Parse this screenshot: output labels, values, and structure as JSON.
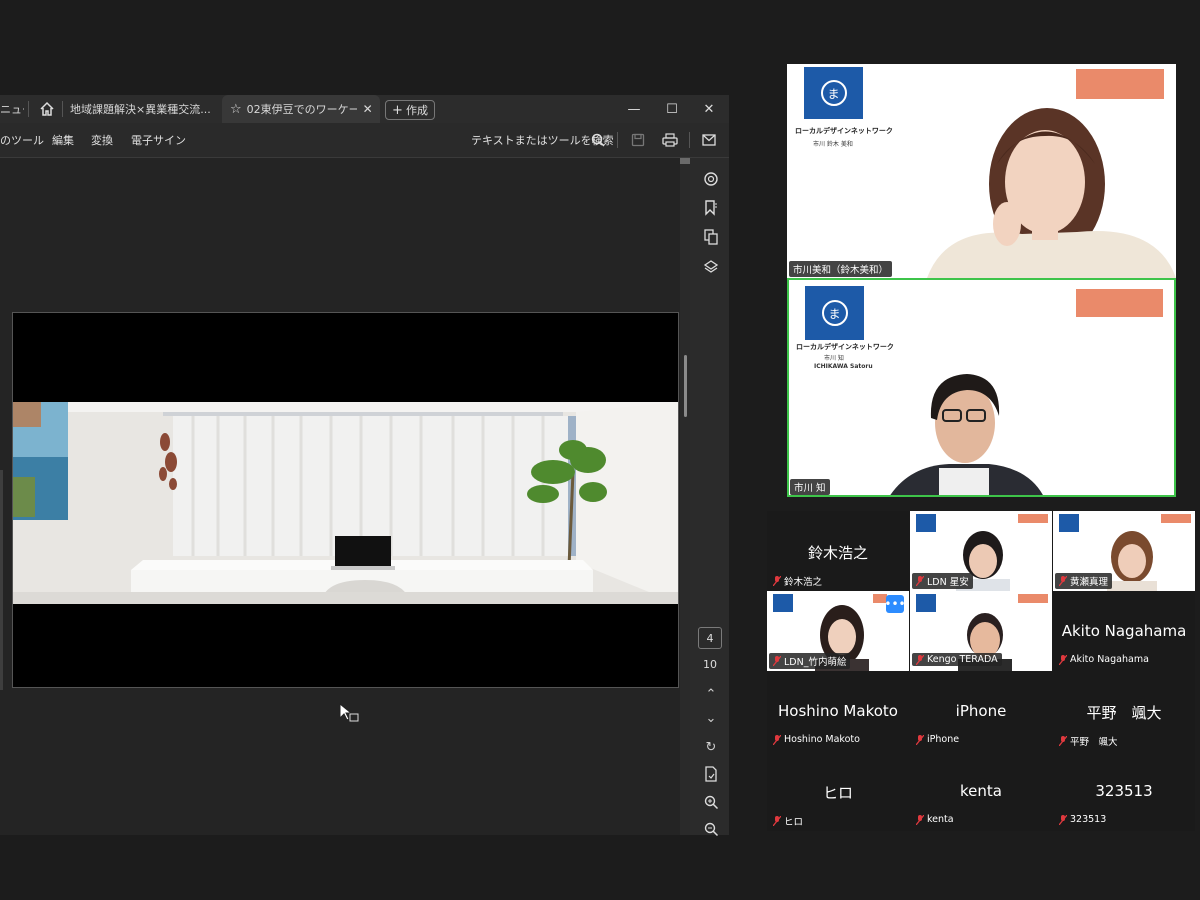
{
  "viewer": {
    "tabs": {
      "menu_partial": "ニュー",
      "tab1": "地域課題解決×異業種交流...",
      "tab2": "02東伊豆でのワーケー...",
      "create": "作成"
    },
    "menu": {
      "tools": "のツール",
      "edit": "編集",
      "convert": "変換",
      "esign": "電子サイン",
      "search": "テキストまたはツールを検索"
    },
    "page_current": "4",
    "page_total": "10"
  },
  "participants": {
    "speaker1": {
      "name": "市川美和（鈴木美和）",
      "org": "ローカルデザインネットワーク",
      "person": "市川 鈴木 美和",
      "logo_char": "ま"
    },
    "speaker2": {
      "name": "市川 知",
      "org": "ローカルデザインネットワーク",
      "person": "市川 知",
      "person_en": "ICHIKAWA Satoru",
      "logo_char": "ま"
    },
    "grid": [
      {
        "tag": "鈴木浩之",
        "big": "鈴木浩之"
      },
      {
        "tag": "LDN 星安"
      },
      {
        "tag": "黄瀬真理"
      },
      {
        "tag": "LDN_竹内萌絵"
      },
      {
        "tag": "Kengo TERADA"
      },
      {
        "tag": "Akito Nagahama",
        "big": "Akito Nagahama"
      },
      {
        "tag": "Hoshino Makoto",
        "big": "Hoshino Makoto"
      },
      {
        "tag": "iPhone",
        "big": "iPhone"
      },
      {
        "tag": "平野　颯大",
        "big": "平野　颯大"
      },
      {
        "tag": "ヒロ",
        "big": "ヒロ"
      },
      {
        "tag": "kenta",
        "big": "kenta"
      },
      {
        "tag": "323513",
        "big": "323513"
      }
    ]
  },
  "colors": {
    "active_speaker_border": "#3ec44a",
    "logo_blue": "#1d5aa8",
    "banner_orange": "#ea8a6a",
    "muted_mic": "#e0393e"
  }
}
